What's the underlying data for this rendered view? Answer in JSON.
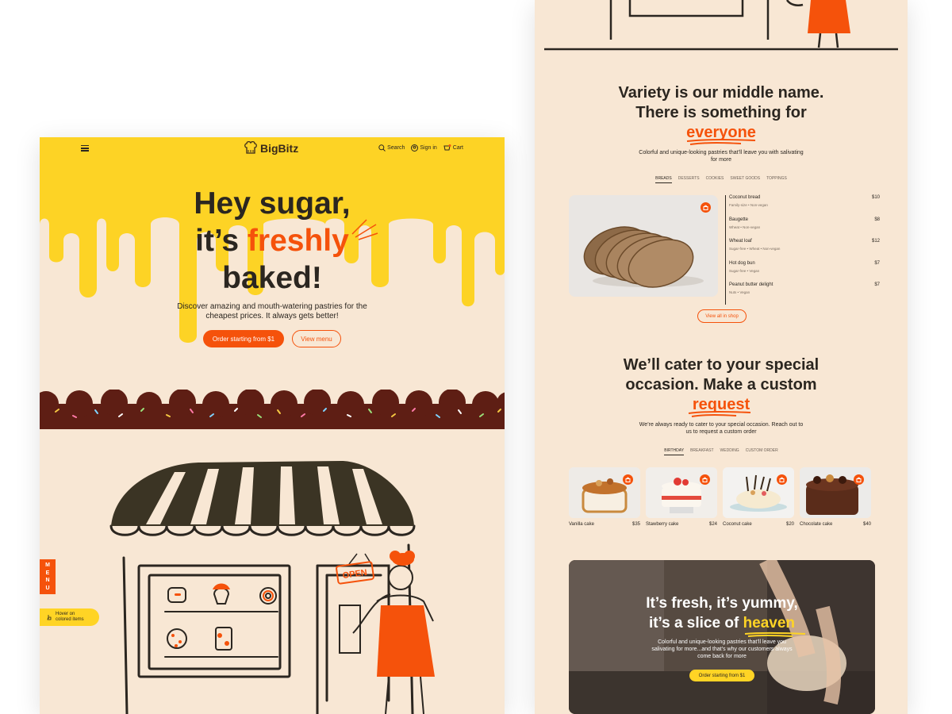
{
  "brand": {
    "name": "BigBitz"
  },
  "nav": {
    "search": "Search",
    "signin": "Sign in",
    "cart": "Cart"
  },
  "hero": {
    "line1": "Hey sugar,",
    "line2_pre": "it’s ",
    "line2_accent": "freshly",
    "line3": "baked!",
    "subtitle": "Discover amazing and mouth-watering pastries for the cheapest prices. It always gets better!",
    "cta_primary": "Order starting from $1",
    "cta_secondary": "View menu"
  },
  "side": {
    "menu_tab": "MENU",
    "hover_hint_1": "Hover on",
    "hover_hint_2": "colored items"
  },
  "shop_sign": "OPEN",
  "variety": {
    "title_1": "Variety is our middle name.",
    "title_2": "There is something for",
    "title_accent": "everyone",
    "subtitle": "Colorful and unique-looking pastries that’ll leave you with salivating for more",
    "tabs": [
      "BREADS",
      "DESSERTS",
      "COOKIES",
      "SWEET GOODS",
      "TOPPINGS"
    ],
    "items": [
      {
        "name": "Coconut bread",
        "tags": "Family-size • Non-vegan",
        "price": "$10"
      },
      {
        "name": "Baugette",
        "tags": "Wheat • Non-vegan",
        "price": "$8"
      },
      {
        "name": "Wheat loaf",
        "tags": "Sugar-free • Wheat • Non-vegan",
        "price": "$12"
      },
      {
        "name": "Hot dog bun",
        "tags": "Sugar-free • Vegan",
        "price": "$7"
      },
      {
        "name": "Peanut butter delight",
        "tags": "Nuts • Vegan",
        "price": "$7"
      }
    ],
    "view_all": "View all in shop"
  },
  "occasion": {
    "title_1": "We’ll cater to your special",
    "title_2": "occasion. Make a custom",
    "title_accent": "request",
    "subtitle": "We’re always ready to cater to your special occasion. Reach out to us to request a custom order",
    "tabs": [
      "BIRTHDAY",
      "BREAKFAST",
      "WEDDING",
      "CUSTOM ORDER"
    ],
    "cakes": [
      {
        "name": "Vanilla cake",
        "price": "$35"
      },
      {
        "name": "Stawberry cake",
        "price": "$24"
      },
      {
        "name": "Coconut cake",
        "price": "$20"
      },
      {
        "name": "Chocolate cake",
        "price": "$40"
      }
    ]
  },
  "banner": {
    "title_1": "It’s fresh, it’s yummy,",
    "title_2_pre": "it’s a slice of ",
    "title_2_accent": "heaven",
    "subtitle": "Colorful and unique-looking pastries that’ll leave you salivating for more...and that’s why our customers always come back for more",
    "cta": "Order starting from $1"
  },
  "colors": {
    "accent": "#f5520b",
    "yellow": "#ffd425",
    "cream": "#f8e7d4",
    "chocolate": "#5e1e14",
    "ink": "#2b2620"
  }
}
